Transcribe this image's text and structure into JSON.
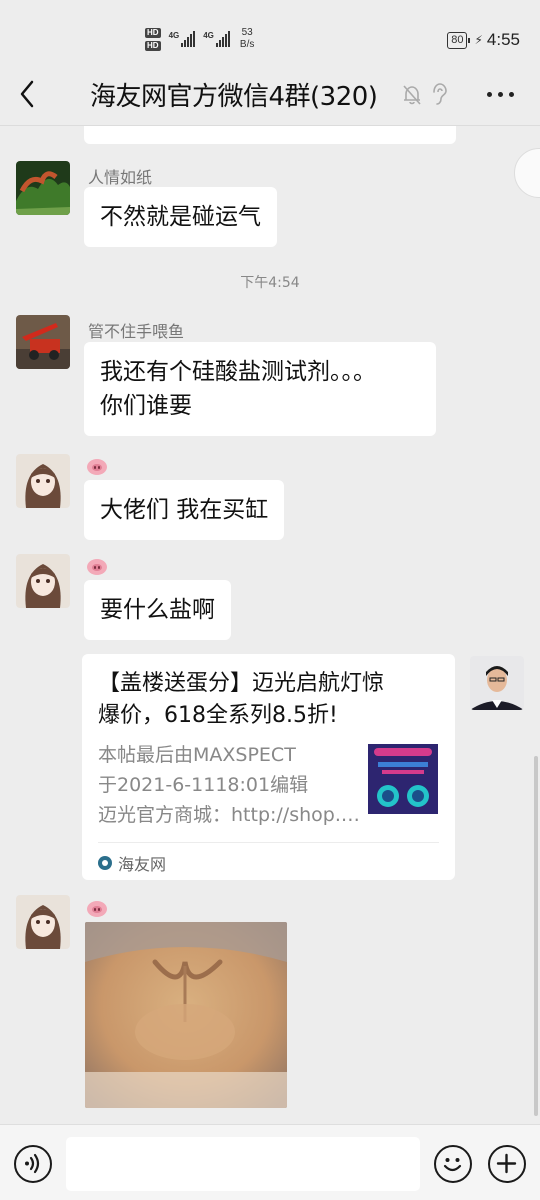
{
  "status_bar": {
    "sim1": "HD",
    "sim2": "HD",
    "net1": "4G",
    "net2": "4G",
    "speed_value": "53",
    "speed_unit": "B/s",
    "battery": "80",
    "time": "4:55"
  },
  "header": {
    "title": "海友网官方微信4群(320)"
  },
  "messages": [
    {
      "sender": "人情如纸",
      "text": "不然就是碰运气"
    },
    {
      "timestamp": "下午4:54"
    },
    {
      "sender": "管不住手喂鱼",
      "lines": [
        "我还有个硅酸盐测试剂。。。",
        "你们谁要"
      ]
    },
    {
      "text": "大佬们 我在买缸"
    },
    {
      "text": "要什么盐啊"
    },
    {
      "card": {
        "title_line1": "【盖楼送蛋分】迈光启航灯惊",
        "title_line2": "爆价，618全系列8.5折!",
        "desc_line1": "本帖最后由MAXSPECT",
        "desc_line2": "于2021-6-1118:01编辑",
        "desc_line3": "迈光官方商城：http://shop.maxspect.com",
        "source": "海友网"
      }
    }
  ],
  "icons": {
    "back": "chevron-left-icon",
    "mute": "bell-off-icon",
    "ear": "ear-icon",
    "more": "more-dots-icon",
    "voice": "voice-icon",
    "emoji": "emoji-icon",
    "plus": "plus-icon"
  },
  "colors": {
    "background": "#ededed",
    "bubble": "#ffffff",
    "pig_badge": "#f3a9b8"
  },
  "input": {
    "value": "",
    "placeholder": ""
  }
}
